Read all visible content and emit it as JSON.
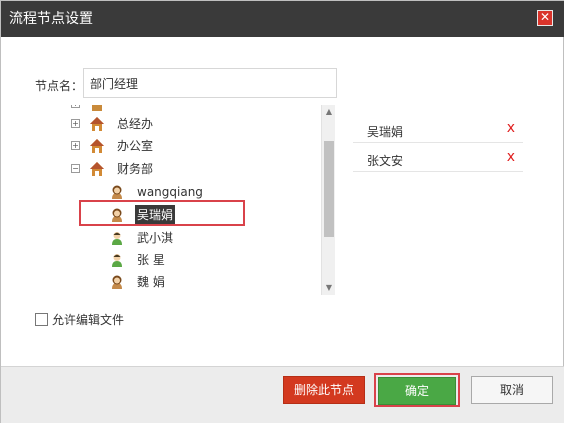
{
  "dialog": {
    "title": "流程节点设置",
    "close_glyph": "✕"
  },
  "node_name": {
    "label": "节点名：",
    "value": "部门经理"
  },
  "tree": {
    "partial_top_label": "...",
    "items": [
      {
        "label": "总经办",
        "expander": "+"
      },
      {
        "label": "办公室",
        "expander": "+"
      },
      {
        "label": "财务部",
        "expander": "−"
      }
    ],
    "members": [
      {
        "label": "wangqiang",
        "gender": "female"
      },
      {
        "label": "吴瑞娟",
        "gender": "female"
      },
      {
        "label": "武小淇",
        "gender": "male"
      },
      {
        "label": "张 星",
        "gender": "male"
      },
      {
        "label": "魏 娟",
        "gender": "female"
      }
    ]
  },
  "scrollbar": {
    "up_glyph": "▲",
    "down_glyph": "▼"
  },
  "selected": {
    "remove_glyph": "x",
    "items": [
      {
        "name": "吴瑞娟"
      },
      {
        "name": "张文安"
      }
    ]
  },
  "allow_edit": {
    "label": "允许编辑文件"
  },
  "buttons": {
    "delete": "删除此节点",
    "ok": "确定",
    "cancel": "取消"
  },
  "colors": {
    "titlebar": "#3a3a3a",
    "delete_button": "#d3391f",
    "ok_button": "#4aa845",
    "remove_x": "#e02020",
    "highlight": "#d9424a"
  }
}
